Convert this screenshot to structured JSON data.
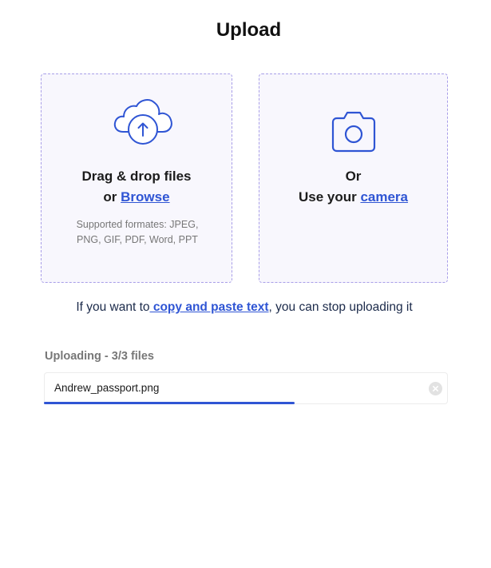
{
  "header": {
    "title": "Upload"
  },
  "dropzone_files": {
    "icon": "cloud-upload-icon",
    "line1": "Drag & drop files",
    "line2_prefix": "or ",
    "browse_link": "Browse",
    "supported_formats": "Supported formates: JPEG, PNG, GIF, PDF, Word, PPT"
  },
  "dropzone_camera": {
    "icon": "camera-icon",
    "line1": "Or",
    "line2_prefix": "Use your ",
    "camera_link": "camera "
  },
  "paste": {
    "prefix": "If you want to",
    "link": " copy and paste text",
    "suffix": ", you can stop uploading it"
  },
  "upload_status": {
    "label": "Uploading - 3/3 files",
    "files": [
      {
        "name": "Andrew_passport.png",
        "progress": 0.62
      }
    ]
  },
  "colors": {
    "accent": "#2f55d4",
    "dropzone_border": "#a89ee8",
    "dropzone_bg": "#f8f7fd",
    "muted_text": "#777777"
  }
}
